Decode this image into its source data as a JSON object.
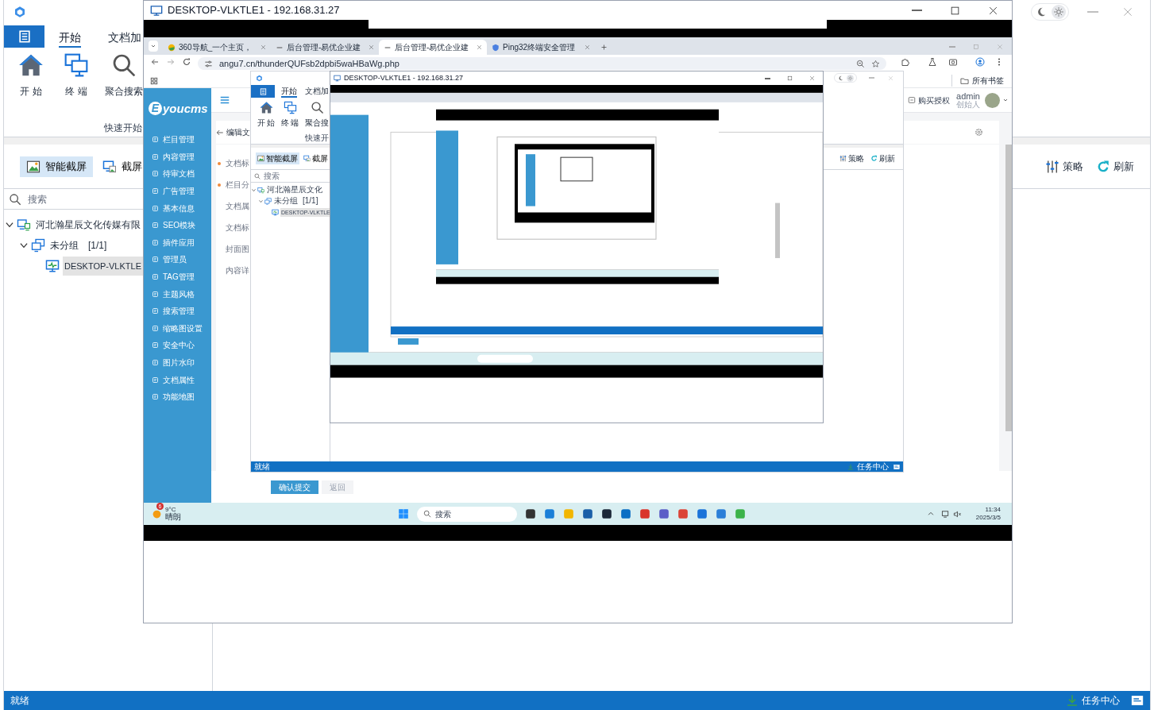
{
  "app": {
    "theme_options": [
      {
        "kind": "dark",
        "selected": false
      },
      {
        "kind": "light",
        "selected": true
      }
    ],
    "ribbon_tabs": [
      {
        "label": "开始",
        "selected": true
      },
      {
        "label": "文档加",
        "selected": false
      }
    ],
    "ribbon_buttons": [
      {
        "label": "开 始",
        "kind": "home"
      },
      {
        "label": "终 端",
        "kind": "terminal"
      },
      {
        "label": "聚合搜索",
        "kind": "search"
      }
    ],
    "group_label": "快速开始",
    "toolbar": [
      {
        "label": "智能截屏",
        "kind": "capture",
        "selected": true
      },
      {
        "label": "截屏",
        "kind": "review",
        "selected": false
      }
    ],
    "actions": [
      {
        "label": "策略",
        "kind": "policy"
      },
      {
        "label": "刷新",
        "kind": "refresh"
      }
    ],
    "search": {
      "placeholder": "搜索"
    },
    "tree": [
      {
        "label": "河北瀚星辰文化传媒有限",
        "kind": "company",
        "expanded": true,
        "selected": false,
        "children": [
          {
            "label": "未分组",
            "count": "[1/1]",
            "kind": "group",
            "expanded": true,
            "selected": false,
            "children": [
              {
                "label": "DESKTOP-VLKTLE",
                "kind": "device",
                "selected": true
              }
            ]
          }
        ]
      }
    ],
    "status_bar": {
      "text": "就绪",
      "task_center": "任务中心"
    }
  },
  "remote_window": {
    "title": "DESKTOP-VLKTLE1 - 192.168.31.27",
    "browser": {
      "tabs": [
        {
          "title": "360导航_一个主页，",
          "kind": "site",
          "selected": false
        },
        {
          "title": "后台管理-易优企业建",
          "kind": "cms",
          "selected": false
        },
        {
          "title": "后台管理-易优企业建",
          "kind": "cms",
          "selected": true
        },
        {
          "title": "Ping32终端安全管理",
          "kind": "shield",
          "selected": false
        }
      ],
      "url": "angu7.cn/thunderQUFsb2dpbi5waHBaWg.php",
      "bookmarks": "所有书签",
      "cms": {
        "logo": {
          "mark": "E",
          "text": "youcms"
        },
        "menu": [
          "栏目管理",
          "内容管理",
          "待审文档",
          "广告管理",
          "基本信息",
          "SEO模块",
          "插件应用",
          "管理员",
          "TAG管理",
          "主题风格",
          "搜索管理",
          "缩略图设置",
          "安全中心",
          "图片水印",
          "文档属性",
          "功能地图"
        ],
        "header": {
          "buy": "购买授权",
          "user": "admin",
          "role": "创始人"
        },
        "page_title": "编辑文",
        "form_labels": [
          {
            "label": "文档标",
            "required": true
          },
          {
            "label": "栏目分",
            "required": true
          },
          {
            "label": "文档属",
            "required": false
          },
          {
            "label": "文档标",
            "required": false
          },
          {
            "label": "封面图",
            "required": false
          },
          {
            "label": "内容详",
            "required": false
          }
        ],
        "buttons": [
          {
            "label": "确认提交",
            "kind": "primary"
          },
          {
            "label": "返回",
            "kind": "secondary"
          }
        ]
      }
    }
  },
  "nested_app": {
    "theme_options": [
      {
        "kind": "dark",
        "selected": false
      },
      {
        "kind": "light",
        "selected": true
      }
    ],
    "ribbon_tabs": [
      {
        "label": "开始",
        "selected": true
      },
      {
        "label": "文档加",
        "selected": false
      }
    ],
    "ribbon_buttons": [
      {
        "label": "开 始",
        "kind": "home"
      },
      {
        "label": "终 端",
        "kind": "terminal"
      },
      {
        "label": "聚合搜",
        "kind": "search"
      }
    ],
    "group_label": "快速开",
    "toolbar": [
      {
        "label": "智能截屏",
        "kind": "capture",
        "selected": true
      },
      {
        "label": "截屏",
        "kind": "review",
        "selected": false
      }
    ],
    "actions": [
      {
        "label": "策略",
        "kind": "policy"
      },
      {
        "label": "刷新",
        "kind": "refresh"
      }
    ],
    "search": {
      "placeholder": "搜索"
    },
    "tree": [
      {
        "label": "河北瀚星辰文化",
        "kind": "company",
        "expanded": true,
        "selected": false,
        "children": [
          {
            "label": "未分组",
            "count": "[1/1]",
            "kind": "group",
            "expanded": true,
            "selected": false,
            "children": [
              {
                "label": "DESKTOP-VLKTLE",
                "kind": "device",
                "selected": true
              }
            ]
          }
        ]
      }
    ],
    "status_bar": {
      "text": "就绪",
      "task_center": "任务中心"
    }
  },
  "inner_window": {
    "title": "DESKTOP-VLKTLE1 - 192.168.31.27"
  },
  "taskbar": {
    "weather_badge": "6",
    "temperature": "9°C",
    "weather": "晴朗",
    "search": "搜索",
    "time": "11:34",
    "date": "2025/3/5"
  }
}
